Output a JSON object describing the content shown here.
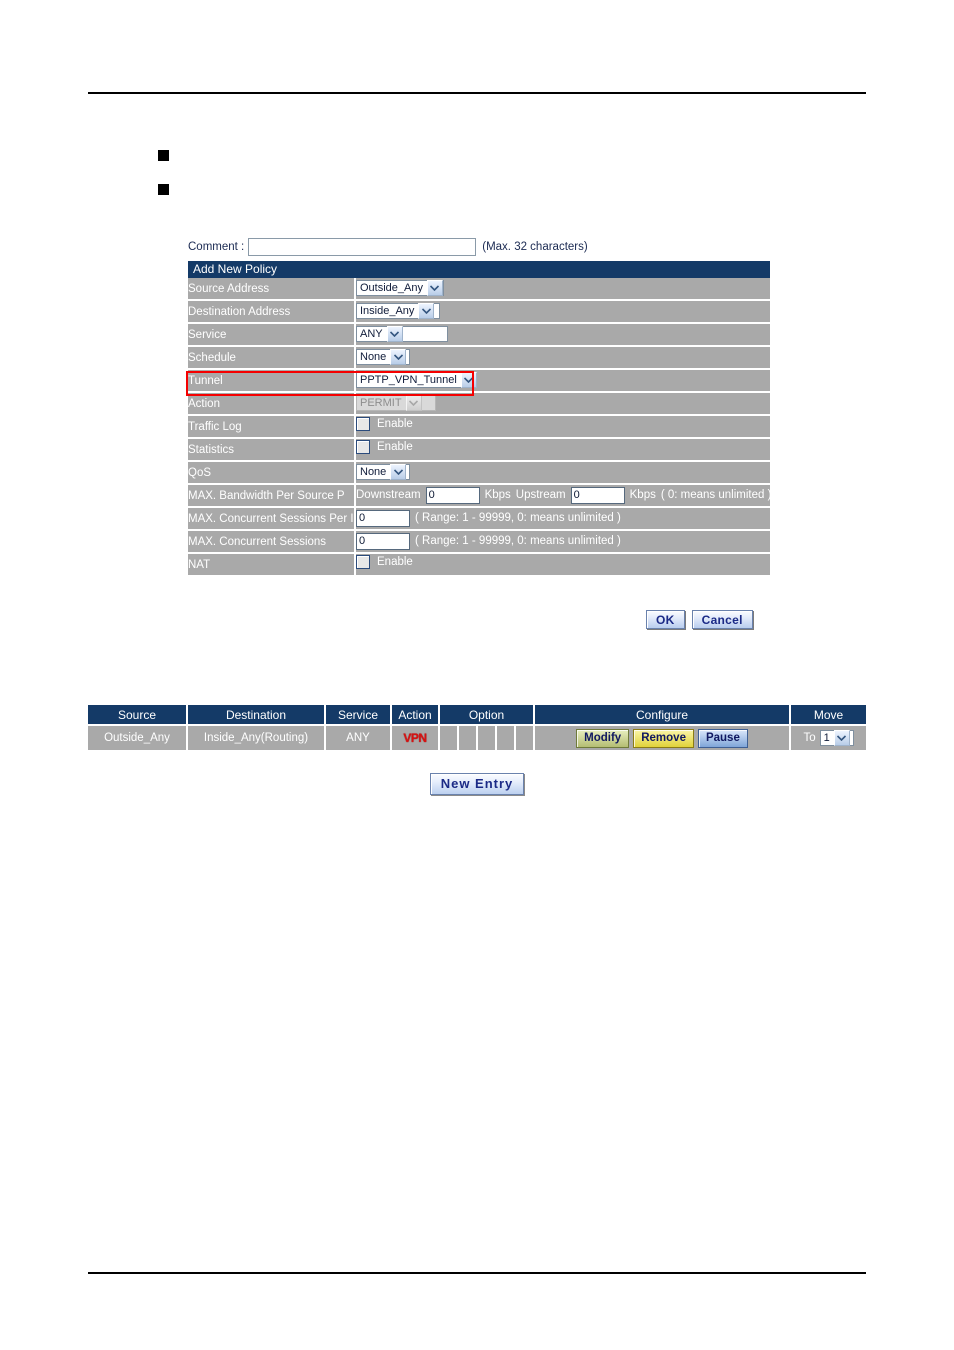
{
  "page": {
    "bullets": [
      "",
      ""
    ]
  },
  "form": {
    "comment_label": "Comment :",
    "comment_value": "",
    "comment_placeholder": "",
    "comment_note": "(Max. 32 characters)",
    "title": "Add New Policy",
    "rows": {
      "source_address": {
        "label": "Source Address",
        "value": "Outside_Any"
      },
      "destination_address": {
        "label": "Destination Address",
        "value": "Inside_Any"
      },
      "service": {
        "label": "Service",
        "value": "ANY"
      },
      "schedule": {
        "label": "Schedule",
        "value": "None"
      },
      "tunnel": {
        "label": "Tunnel",
        "value": "PPTP_VPN_Tunnel"
      },
      "action": {
        "label": "Action",
        "value": "PERMIT"
      },
      "traffic_log": {
        "label": "Traffic Log",
        "enable_label": "Enable"
      },
      "statistics": {
        "label": "Statistics",
        "enable_label": "Enable"
      },
      "qos": {
        "label": "QoS",
        "value": "None"
      },
      "max_bandwidth": {
        "label": "MAX. Bandwidth Per Source P",
        "downstream_label": "Downstream",
        "downstream_value": "0",
        "kbps_label_1": "Kbps",
        "upstream_label": "Upstream",
        "upstream_value": "0",
        "kbps_label_2": "Kbps",
        "note": "( 0: means unlimited )"
      },
      "max_sessions_per_ip": {
        "label": "MAX. Concurrent Sessions Per IP",
        "value": "0",
        "note": "( Range: 1 - 99999, 0: means unlimited )"
      },
      "max_sessions": {
        "label": "MAX. Concurrent Sessions",
        "value": "0",
        "note": "( Range: 1 - 99999, 0: means unlimited )"
      },
      "nat": {
        "label": "NAT",
        "enable_label": "Enable"
      }
    },
    "buttons": {
      "ok": "OK",
      "cancel": "Cancel"
    }
  },
  "policy_list": {
    "headers": {
      "source": "Source",
      "destination": "Destination",
      "service": "Service",
      "action": "Action",
      "option": "Option",
      "configure": "Configure",
      "move": "Move"
    },
    "row": {
      "source": "Outside_Any",
      "destination": "Inside_Any(Routing)",
      "service": "ANY",
      "action_icon": "VPN",
      "option_cells": [
        "",
        "",
        "",
        "",
        ""
      ],
      "configure": {
        "modify": "Modify",
        "remove": "Remove",
        "pause": "Pause"
      },
      "move": {
        "to_label": "To",
        "value": "1"
      }
    },
    "new_entry_label": "New  Entry"
  },
  "colors": {
    "header_navy": "#143a67",
    "label_gray": "#a9a9a9",
    "highlight_red": "#f50000",
    "vpn_red": "#d81212",
    "text_navy": "#1b2a52"
  }
}
